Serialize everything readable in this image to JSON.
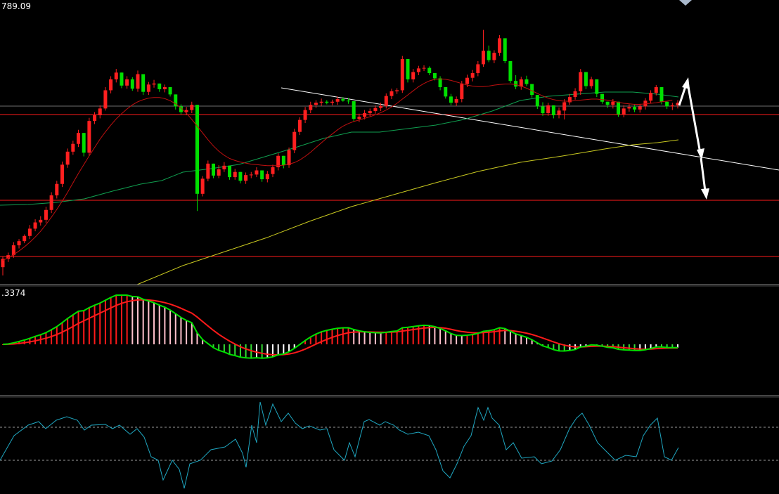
{
  "labels": {
    "price_readout": "789.09",
    "macd_readout": ".3374"
  },
  "colors": {
    "background": "#000000",
    "bull_candle": "#ff2020",
    "bear_candle": "#00e000",
    "ma_fast": "#c01010",
    "ma_mid": "#10a050",
    "ma_slow": "#c8c820",
    "level_line": "#ff1a1a",
    "trend_line": "#ffffff",
    "macd_main": "#00e000",
    "macd_signal": "#ff1a1a",
    "hist_pos_rising": "#ff1a1a",
    "hist_pos_falling": "#ffc0cb",
    "hist_neg_falling": "#33dd33",
    "hist_neg_rising": "#ffffff",
    "oscillator": "#1fa6c0",
    "panel_divider": "#7f7f7f"
  },
  "chart_data": [
    {
      "type": "candlestick",
      "panel": "price",
      "ylim": [
        748,
        800
      ],
      "candles": [
        [
          750,
          752,
          748.4,
          751.6
        ],
        [
          751.6,
          752.8,
          751,
          752.3
        ],
        [
          752.3,
          754.8,
          751.8,
          754.2
        ],
        [
          754.2,
          755.4,
          753.6,
          755
        ],
        [
          755,
          756.3,
          754.6,
          756
        ],
        [
          756,
          758.1,
          755.4,
          757.4
        ],
        [
          757.4,
          759.2,
          756.9,
          758.6
        ],
        [
          758.6,
          759.8,
          758,
          759.1
        ],
        [
          759.1,
          761.6,
          758.5,
          761
        ],
        [
          761,
          764.4,
          760.4,
          763.8
        ],
        [
          763.8,
          766.6,
          763.2,
          766
        ],
        [
          766,
          770.3,
          765.4,
          769.7
        ],
        [
          769.7,
          772.8,
          769.1,
          772.2
        ],
        [
          772.2,
          774.3,
          771.6,
          773.7
        ],
        [
          773.7,
          776.4,
          773.1,
          775.8
        ],
        [
          775.8,
          775.8,
          771.3,
          772
        ],
        [
          772,
          778.7,
          771.4,
          778.1
        ],
        [
          778.1,
          779.8,
          777.5,
          779.2
        ],
        [
          779.2,
          781.1,
          778.6,
          780.5
        ],
        [
          780.5,
          784.6,
          780.1,
          784
        ],
        [
          784,
          786.7,
          783.4,
          786.1
        ],
        [
          786.1,
          788.1,
          785.5,
          787.4
        ],
        [
          787.4,
          787.4,
          784.4,
          784.9
        ],
        [
          784.9,
          786.7,
          784.3,
          786.1
        ],
        [
          786.1,
          786.5,
          783.9,
          784.3
        ],
        [
          784.3,
          787.8,
          783.7,
          787.1
        ],
        [
          787.1,
          787.1,
          783.1,
          783.7
        ],
        [
          783.7,
          785.6,
          783.1,
          785.1
        ],
        [
          785.1,
          786,
          784.5,
          785.3
        ],
        [
          785.3,
          785.3,
          783.7,
          784.2
        ],
        [
          784.2,
          785.1,
          783.6,
          784.6
        ],
        [
          784.6,
          784.6,
          782.8,
          783.2
        ],
        [
          783.2,
          783.2,
          780.3,
          780.9
        ],
        [
          780.9,
          781.3,
          779.4,
          779.8
        ],
        [
          779.8,
          780.8,
          779.2,
          780.2
        ],
        [
          780.2,
          781.8,
          779.6,
          781.2
        ],
        [
          781.2,
          781.2,
          760.8,
          764.1
        ],
        [
          764.1,
          767.5,
          763.6,
          767
        ],
        [
          767,
          770.5,
          766.5,
          769.9
        ],
        [
          769.9,
          769.9,
          767.1,
          767.6
        ],
        [
          767.6,
          769.6,
          767.1,
          768.8
        ],
        [
          768.8,
          770.2,
          768.3,
          769.5
        ],
        [
          769.5,
          769.5,
          766.8,
          767.3
        ],
        [
          767.3,
          768.9,
          766.8,
          768.3
        ],
        [
          768.3,
          768.3,
          766.1,
          766.6
        ],
        [
          766.6,
          768.2,
          766,
          767.7
        ],
        [
          767.7,
          768.3,
          767.1,
          767.8
        ],
        [
          767.8,
          769.2,
          767.3,
          768.6
        ],
        [
          768.6,
          768.6,
          766.4,
          766.9
        ],
        [
          766.9,
          768.5,
          766.3,
          767.9
        ],
        [
          767.9,
          769.7,
          767.3,
          769.2
        ],
        [
          769.2,
          771.9,
          768.6,
          771.4
        ],
        [
          771.4,
          771.4,
          769,
          769.6
        ],
        [
          769.6,
          773,
          769.1,
          772.5
        ],
        [
          772.5,
          776.6,
          771.9,
          776
        ],
        [
          776,
          778.8,
          775.4,
          778.3
        ],
        [
          778.3,
          780.8,
          777.7,
          780.2
        ],
        [
          780.2,
          781.8,
          779.6,
          781.2
        ],
        [
          781.2,
          782.1,
          780.6,
          781.6
        ],
        [
          781.6,
          782.4,
          781,
          781.8
        ],
        [
          781.8,
          782.1,
          781.3,
          781.6
        ],
        [
          781.6,
          782.2,
          781.1,
          781.8
        ],
        [
          781.8,
          782.8,
          781.2,
          782.3
        ],
        [
          782.3,
          782.7,
          781.8,
          782
        ],
        [
          782,
          782.5,
          781.4,
          781.9
        ],
        [
          781.9,
          781.9,
          778,
          778.5
        ],
        [
          778.5,
          779.5,
          777.9,
          778.9
        ],
        [
          778.9,
          780.2,
          778.4,
          779.6
        ],
        [
          779.6,
          780.5,
          779,
          780
        ],
        [
          780,
          781.1,
          779.5,
          780.6
        ],
        [
          780.6,
          781.6,
          780,
          781
        ],
        [
          781,
          783.4,
          780.5,
          782.9
        ],
        [
          782.9,
          784.3,
          782.3,
          783.8
        ],
        [
          783.8,
          784.4,
          783.3,
          784
        ],
        [
          784,
          790.6,
          783.5,
          790
        ],
        [
          790,
          790,
          785.5,
          786.1
        ],
        [
          786.1,
          788.1,
          785.5,
          787.5
        ],
        [
          787.5,
          788.7,
          786.9,
          788.2
        ],
        [
          788.2,
          788.8,
          787.7,
          788.3
        ],
        [
          788.3,
          788.6,
          786.9,
          787.3
        ],
        [
          787.3,
          787.3,
          785.9,
          786.3
        ],
        [
          786.3,
          786.7,
          784,
          784.6
        ],
        [
          784.6,
          784.6,
          782.4,
          782.8
        ],
        [
          782.8,
          783.3,
          781.1,
          781.6
        ],
        [
          781.6,
          782.8,
          781,
          782.3
        ],
        [
          782.3,
          785.8,
          781.7,
          785.2
        ],
        [
          785.2,
          787,
          784.6,
          786.4
        ],
        [
          786.4,
          787.9,
          785.7,
          787.3
        ],
        [
          787.3,
          789.6,
          786.7,
          789
        ],
        [
          789,
          795.6,
          788.5,
          791.6
        ],
        [
          791.6,
          792.6,
          789.4,
          789.8
        ],
        [
          789.8,
          791.7,
          789.2,
          791.2
        ],
        [
          791.2,
          794.6,
          790.6,
          794
        ],
        [
          794,
          794,
          789.2,
          789.6
        ],
        [
          789.6,
          789.6,
          785.4,
          785.8
        ],
        [
          785.8,
          786.9,
          784.2,
          784.7
        ],
        [
          784.7,
          786.6,
          784.1,
          786.1
        ],
        [
          786.1,
          786.8,
          784.8,
          785.2
        ],
        [
          785.2,
          785.2,
          782.6,
          783.1
        ],
        [
          783.1,
          783.1,
          780.4,
          780.9
        ],
        [
          780.9,
          781.7,
          779.1,
          779.6
        ],
        [
          779.6,
          781.6,
          779.1,
          781.1
        ],
        [
          781.1,
          781.1,
          778.6,
          779.2
        ],
        [
          779.2,
          780.7,
          778.6,
          780.1
        ],
        [
          780.1,
          782.3,
          778.4,
          781.7
        ],
        [
          781.7,
          783.3,
          781.2,
          782.7
        ],
        [
          782.7,
          784.4,
          782.2,
          783.8
        ],
        [
          783.8,
          788.1,
          783.1,
          787.5
        ],
        [
          787.5,
          787.5,
          784.2,
          784.8
        ],
        [
          784.8,
          786.6,
          784.3,
          786.1
        ],
        [
          786.1,
          786.1,
          782.7,
          783.3
        ],
        [
          783.3,
          783.3,
          781.4,
          781.8
        ],
        [
          781.8,
          781.8,
          780.6,
          781.2
        ],
        [
          781.2,
          782.3,
          780.5,
          781.8
        ],
        [
          781.8,
          781.8,
          778.9,
          779.4
        ],
        [
          779.4,
          781.1,
          778.8,
          780.5
        ],
        [
          780.5,
          781.3,
          779.9,
          780.8
        ],
        [
          780.8,
          781.2,
          779.8,
          780.3
        ],
        [
          780.3,
          781.4,
          779.7,
          780.9
        ],
        [
          780.9,
          782.5,
          780.3,
          782
        ],
        [
          782,
          784,
          781.5,
          783.5
        ],
        [
          783.5,
          785,
          783,
          784.6
        ],
        [
          784.6,
          784.6,
          781.3,
          781.8
        ],
        [
          781.8,
          781.8,
          780.4,
          780.9
        ],
        [
          780.9,
          781.6,
          780.2,
          781.1
        ],
        [
          781.1,
          782.1,
          780.5,
          781.6
        ]
      ],
      "moving_averages": {
        "ma_fast": [
          751.3,
          751.8,
          752.4,
          753.1,
          753.9,
          754.8,
          755.8,
          756.9,
          758.2,
          759.6,
          761.1,
          762.7,
          764.4,
          766.2,
          768,
          769.7,
          771.4,
          773,
          774.6,
          776,
          777.3,
          778.5,
          779.5,
          780.4,
          781.2,
          781.8,
          782.2,
          782.5,
          782.6,
          782.6,
          782.4,
          782,
          781.4,
          780.6,
          779.6,
          778.4,
          777.1,
          775.8,
          774.5,
          773.3,
          772.3,
          771.5,
          770.9,
          770.5,
          770.2,
          770,
          769.8,
          769.7,
          769.6,
          769.5,
          769.5,
          769.5,
          769.6,
          769.8,
          770.1,
          770.6,
          771.3,
          772.1,
          773,
          773.9,
          774.8,
          775.6,
          776.4,
          777.1,
          777.6,
          778,
          778.3,
          778.6,
          778.9,
          779.3,
          779.7,
          780.2,
          780.8,
          781.5,
          782.3,
          783.1,
          783.9,
          784.7,
          785.3,
          785.8,
          786.1,
          786.2,
          786.1,
          785.9,
          785.6,
          785.3,
          785,
          784.8,
          784.7,
          784.7,
          784.8,
          785,
          785.1,
          785.2,
          785.2,
          785.1,
          784.8,
          784.4,
          783.9,
          783.4,
          782.9,
          782.5,
          782.2,
          782,
          781.9,
          781.9,
          782,
          782.1,
          782.2,
          782.3,
          782.3,
          782.2,
          782.1,
          781.9,
          781.7,
          781.5,
          781.4,
          781.3,
          781.3,
          781.4,
          781.5,
          781.6,
          781.8,
          781.9,
          782.1
        ]
      }
    }
  ]
}
